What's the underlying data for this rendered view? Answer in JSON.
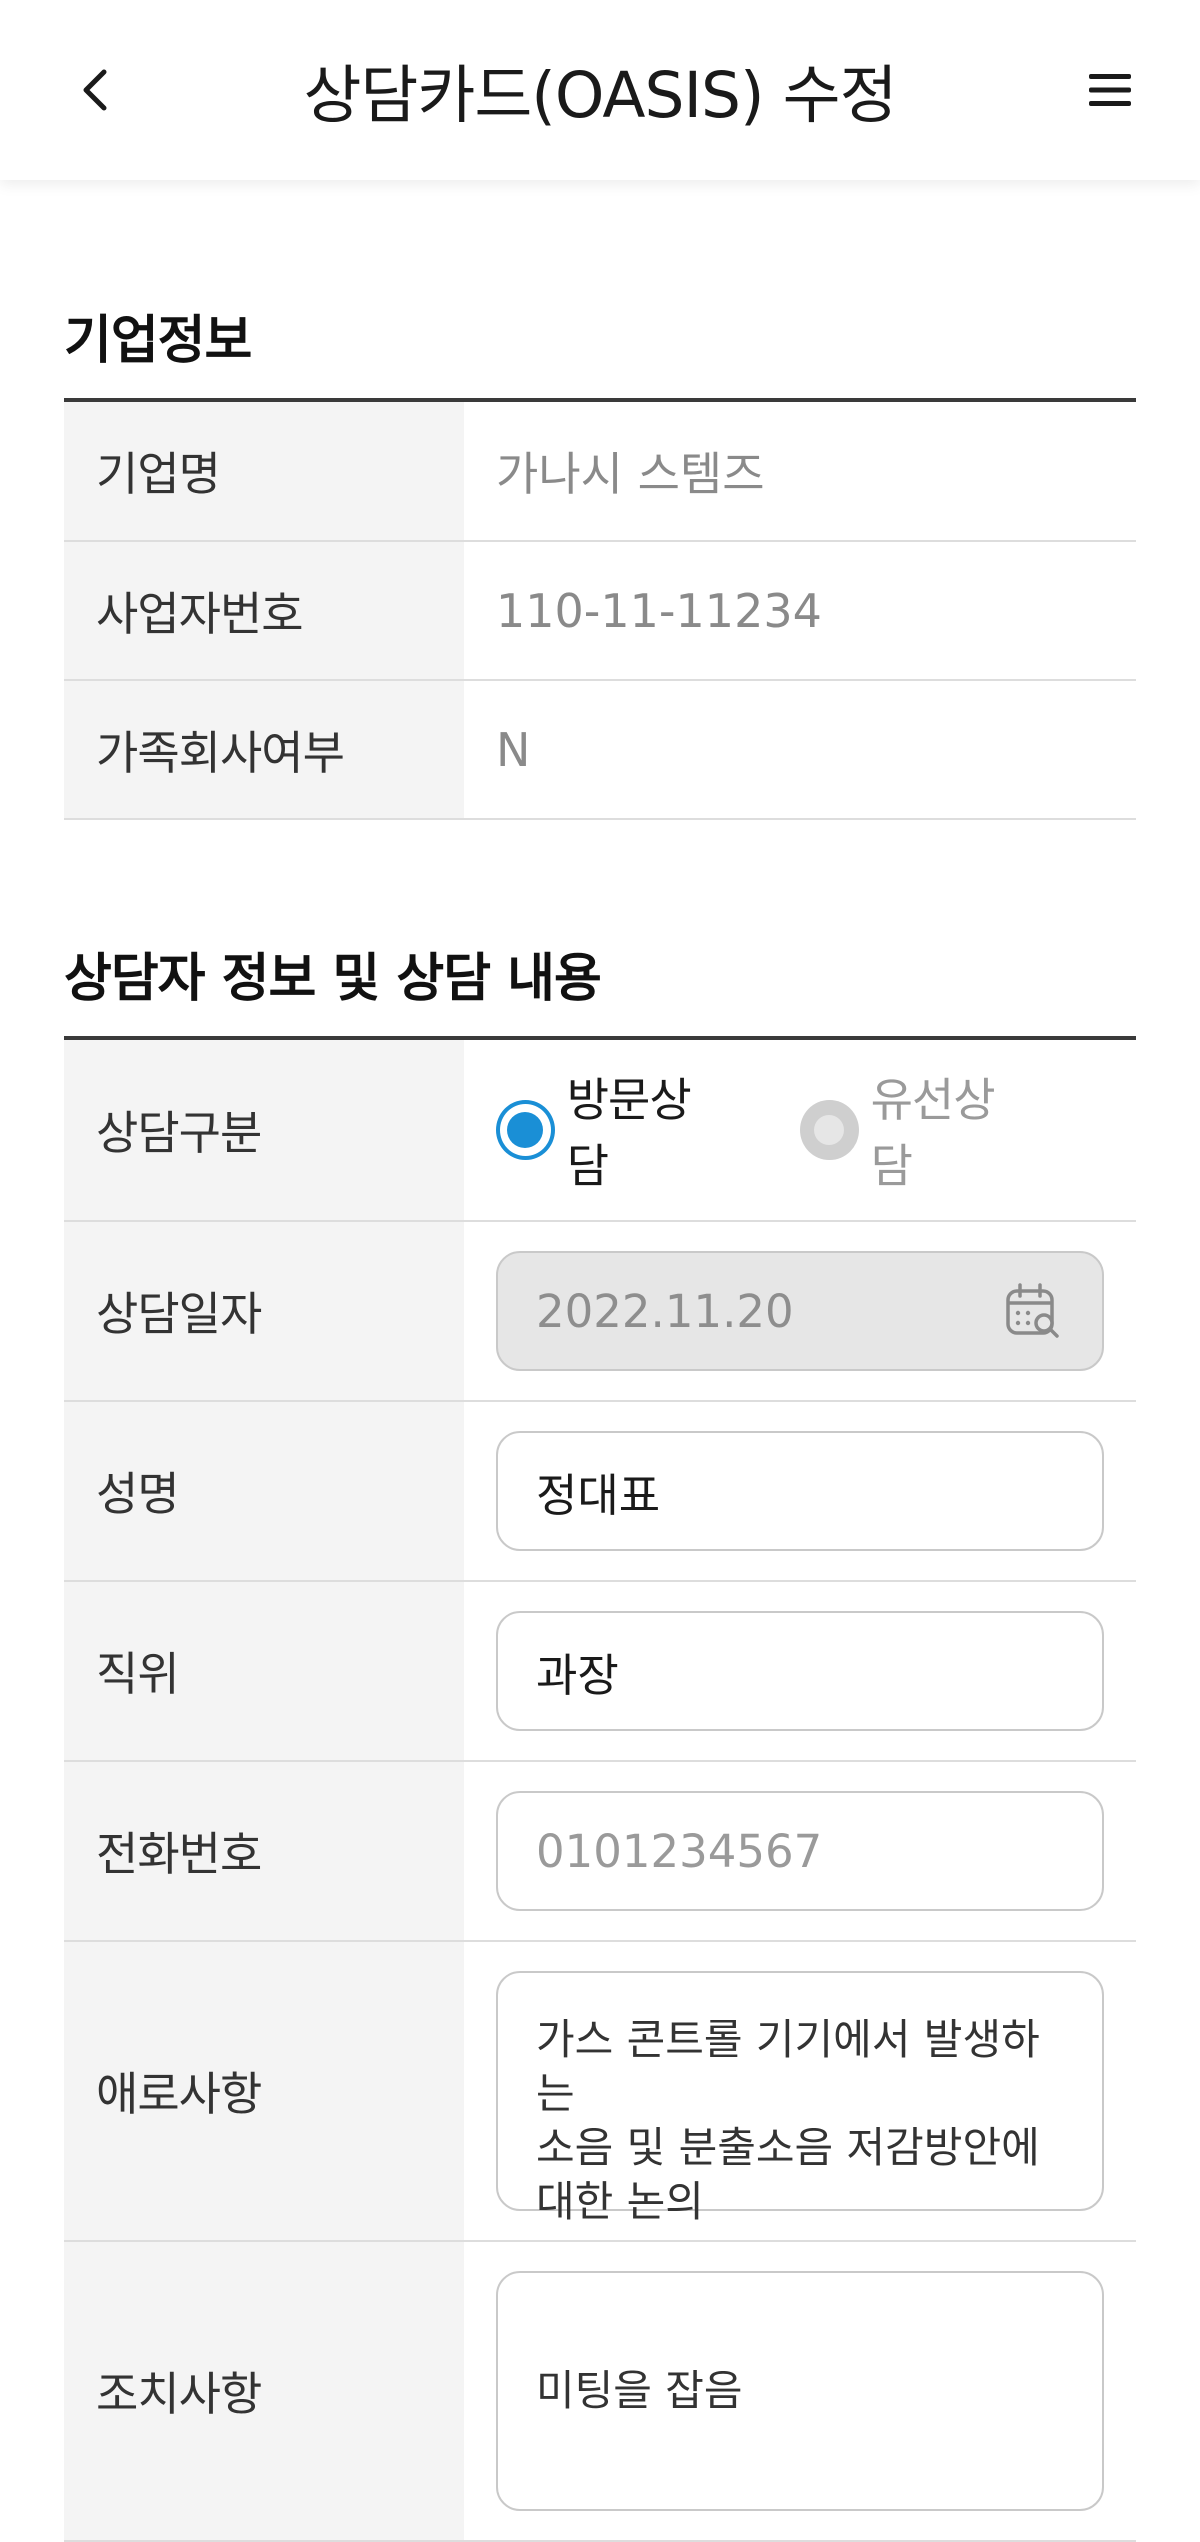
{
  "header": {
    "title": "상담카드(OASIS) 수정",
    "back_icon": "chevron-left-icon",
    "menu_icon": "hamburger-menu-icon"
  },
  "company_section": {
    "title": "기업정보",
    "rows": [
      {
        "label": "기업명",
        "value": "가나시 스템즈"
      },
      {
        "label": "사업자번호",
        "value": "110-11-11234"
      },
      {
        "label": "가족회사여부",
        "value": "N"
      }
    ]
  },
  "consult_section": {
    "title": "상담자 정보 및 상담 내용",
    "type": {
      "label": "상담구분",
      "options": [
        {
          "label": "방문상담",
          "selected": true
        },
        {
          "label": "유선상담",
          "selected": false
        }
      ]
    },
    "date": {
      "label": "상담일자",
      "value": "2022.11.20",
      "icon": "calendar-search-icon"
    },
    "name": {
      "label": "성명",
      "value": "정대표"
    },
    "position": {
      "label": "직위",
      "value": "과장"
    },
    "phone": {
      "label": "전화번호",
      "placeholder": "0101234567"
    },
    "difficulty": {
      "label": "애로사항",
      "value": "가스 콘트롤 기기에서 발생하는\n소음 및 분출소음 저감방안에\n대한 논의"
    },
    "action": {
      "label": "조치사항",
      "value": "미팅을 잡음"
    }
  },
  "colors": {
    "accent": "#1a8fd6",
    "label_bg": "#f4f4f4",
    "disabled_bg": "#e6e6e6"
  }
}
